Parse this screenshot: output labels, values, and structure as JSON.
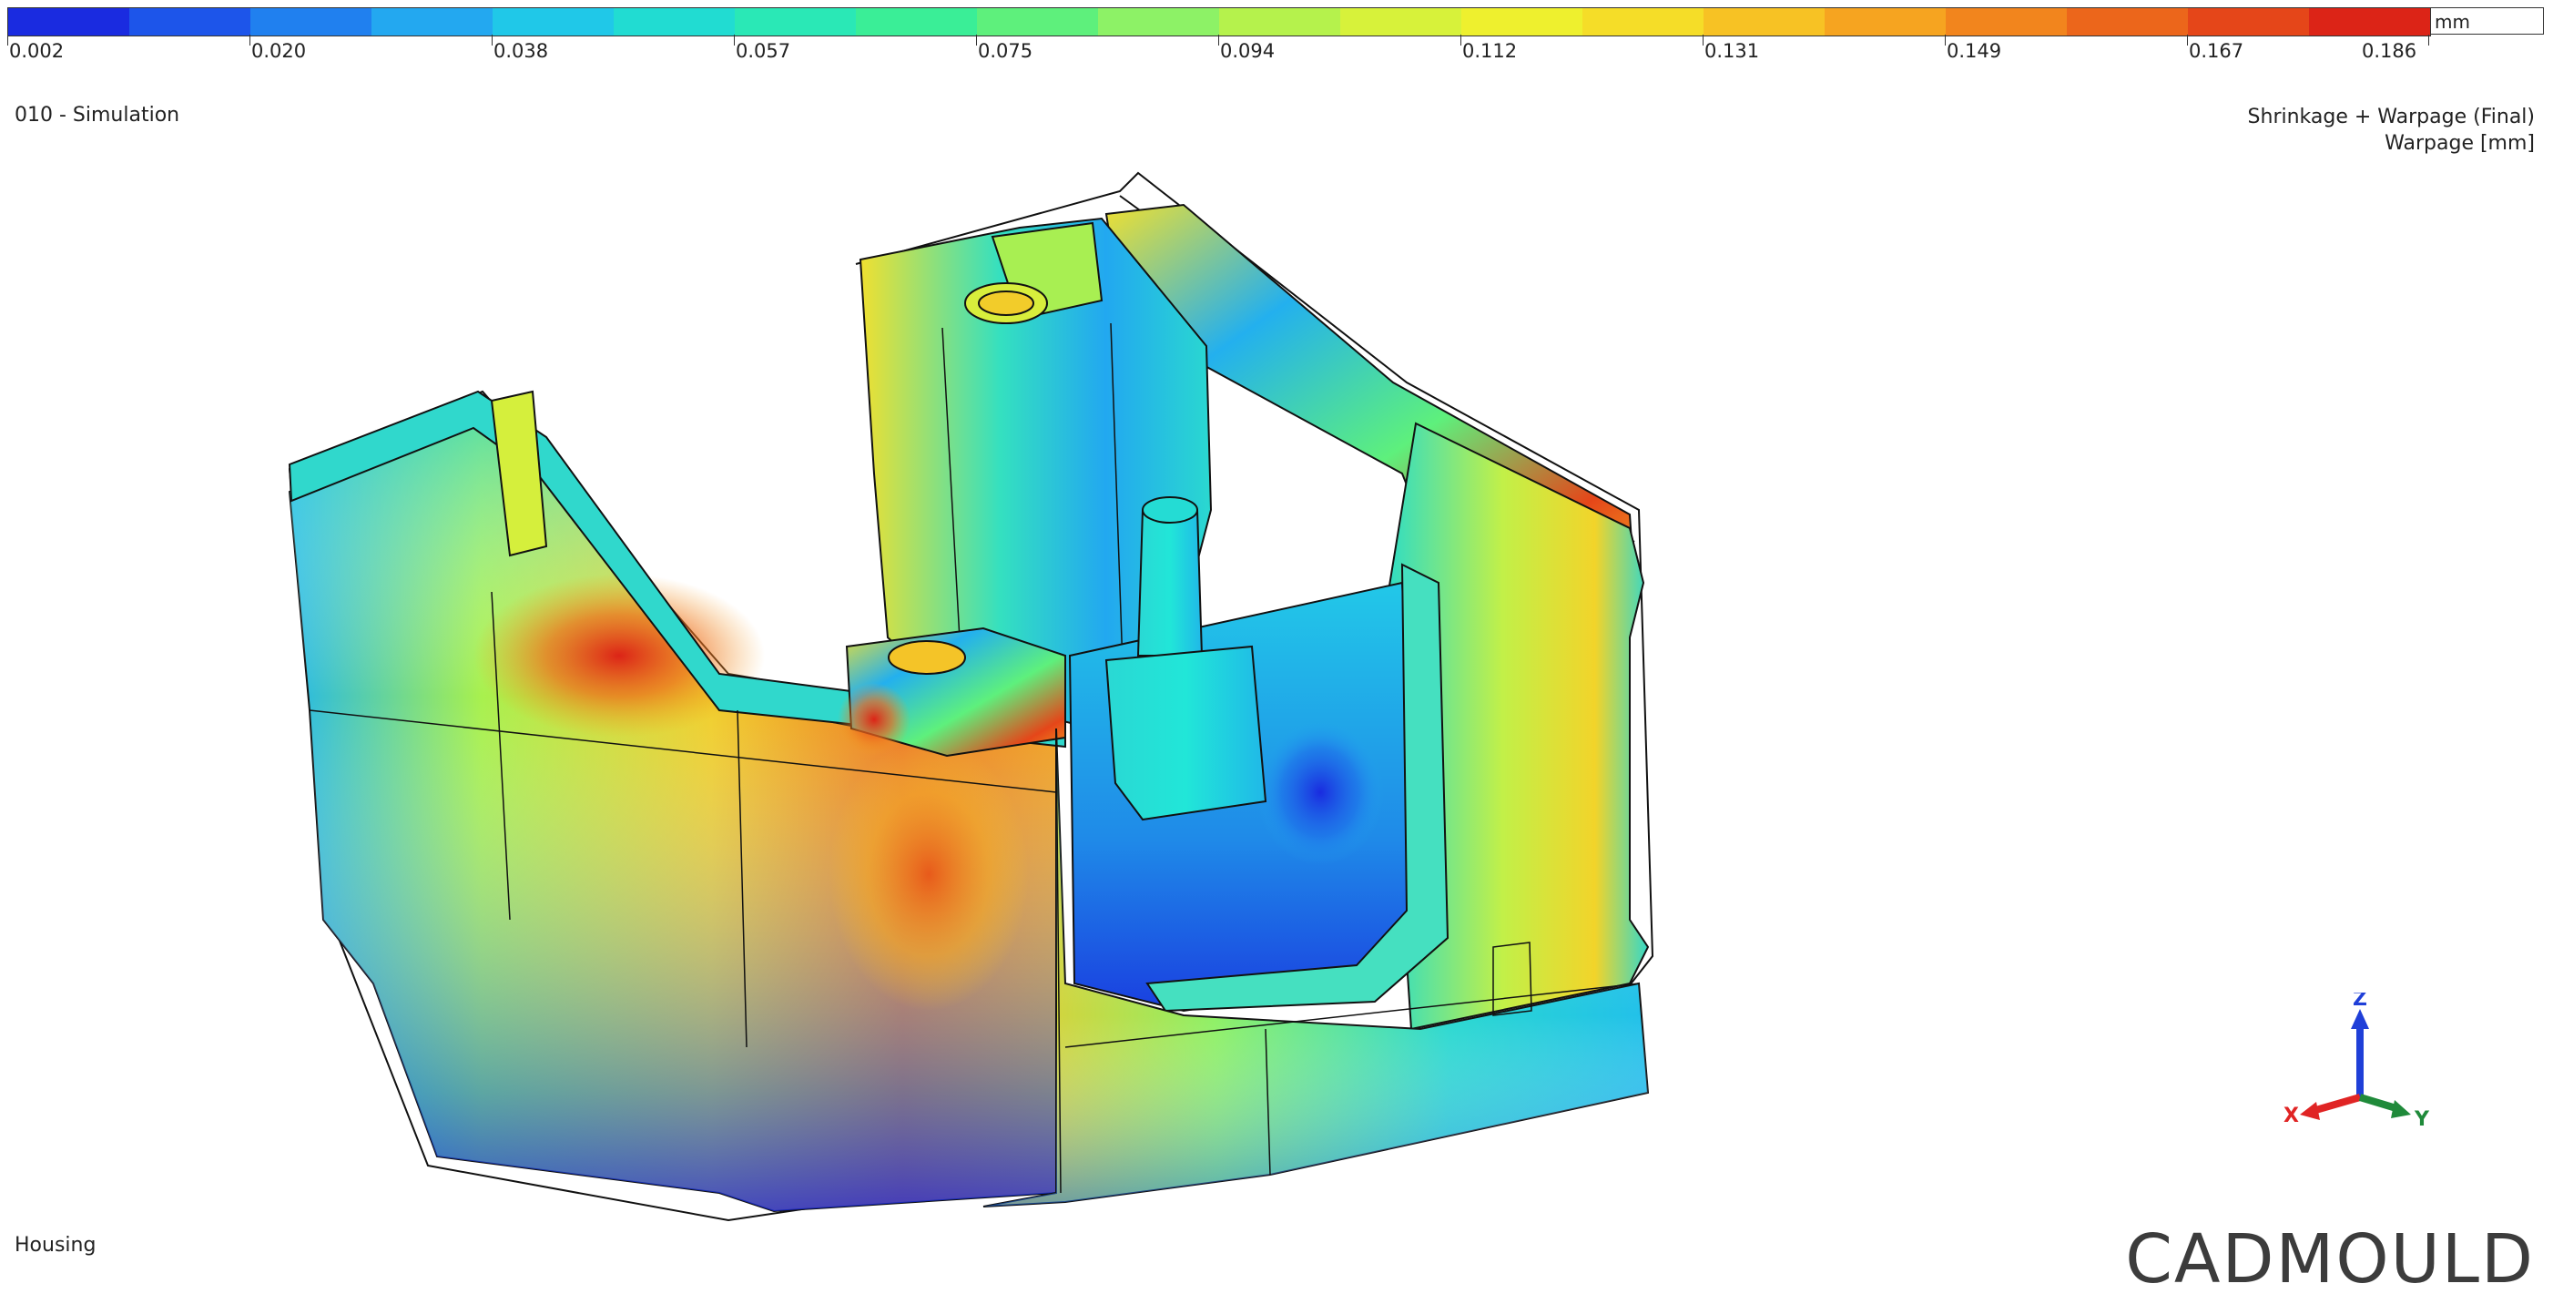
{
  "legend": {
    "unit": "mm",
    "labels": [
      "0.002",
      "0.020",
      "0.038",
      "0.057",
      "0.075",
      "0.094",
      "0.112",
      "0.131",
      "0.149",
      "0.167",
      "0.186"
    ],
    "colors": [
      "#1a2be0",
      "#1d55ea",
      "#2080ef",
      "#23a8f0",
      "#20c8e8",
      "#21dcd2",
      "#2ae8b6",
      "#3aee97",
      "#5ef07c",
      "#8df266",
      "#b5f24c",
      "#d7f23a",
      "#eef02e",
      "#f5dd28",
      "#f7c224",
      "#f6a420",
      "#f2851d",
      "#ec661b",
      "#e54619",
      "#dc2417"
    ]
  },
  "simulation_name": "010 - Simulation",
  "result": {
    "line1": "Shrinkage + Warpage (Final)",
    "line2": "Warpage [mm]"
  },
  "part_name": "Housing",
  "brand": "CADMOULD",
  "triad": {
    "z": "Z",
    "x": "X",
    "y": "Y"
  },
  "colors": {
    "axis_z": "#1f3fd8",
    "axis_x": "#e02424",
    "axis_y": "#1f8a3a"
  }
}
